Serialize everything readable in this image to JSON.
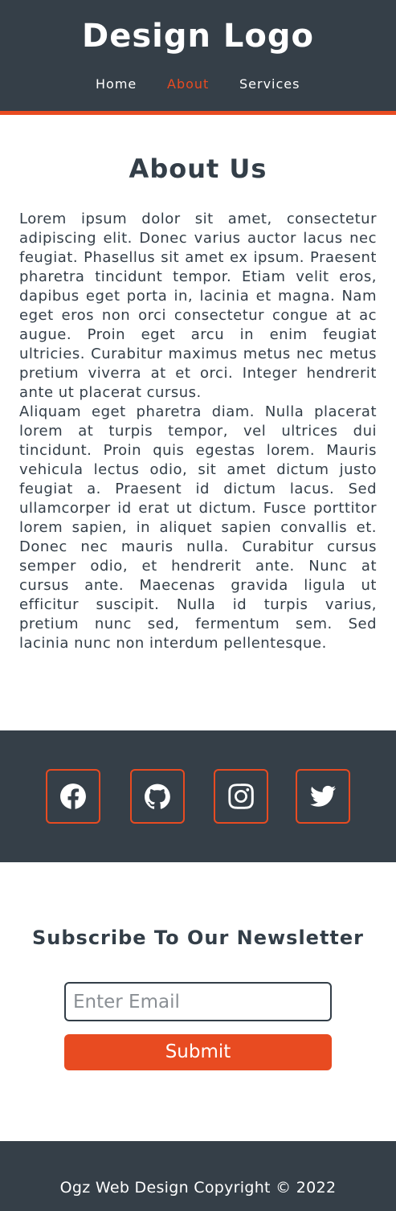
{
  "header": {
    "logo": "Design Logo",
    "nav": [
      {
        "label": "Home",
        "active": false
      },
      {
        "label": "About",
        "active": true
      },
      {
        "label": "Services",
        "active": false
      }
    ]
  },
  "about": {
    "title": "About Us",
    "paragraphs": [
      "Lorem ipsum dolor sit amet, consectetur adipiscing elit. Donec varius auctor lacus nec feugiat. Phasellus sit amet ex ipsum. Praesent pharetra tincidunt tempor. Etiam velit eros, dapibus eget porta in, lacinia et magna. Nam eget eros non orci consectetur congue at ac augue. Proin eget arcu in enim feugiat ultricies. Curabitur maximus metus nec metus pretium viverra at et orci. Integer hendrerit ante ut placerat cursus.",
      "Aliquam eget pharetra diam. Nulla placerat lorem at turpis tempor, vel ultrices dui tincidunt. Proin quis egestas lorem. Mauris vehicula lectus odio, sit amet dictum justo feugiat a. Praesent id dictum lacus. Sed ullamcorper id erat ut dictum. Fusce porttitor lorem sapien, in aliquet sapien convallis et. Donec nec mauris nulla. Curabitur cursus semper odio, et hendrerit ante. Nunc at cursus ante. Maecenas gravida ligula ut efficitur suscipit. Nulla id turpis varius, pretium nunc sed, fermentum sem. Sed lacinia nunc non interdum pellentesque."
    ]
  },
  "social": {
    "icons": [
      "facebook-icon",
      "github-icon",
      "instagram-icon",
      "twitter-icon"
    ]
  },
  "newsletter": {
    "title": "Subscribe To Our Newsletter",
    "email_placeholder": "Enter Email",
    "email_value": "",
    "submit_label": "Submit"
  },
  "footer": {
    "copyright": "Ogz Web Design Copyright © 2022"
  },
  "colors": {
    "dark": "#353f48",
    "accent": "#e84b21",
    "text": "#333e48",
    "white": "#ffffff"
  }
}
